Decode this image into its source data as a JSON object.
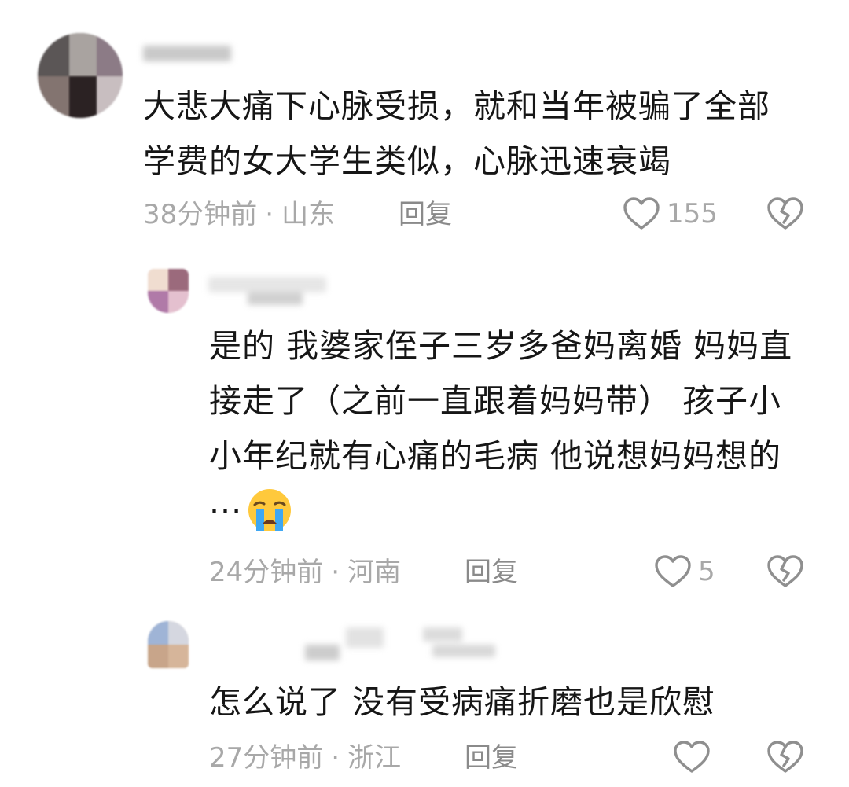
{
  "comments": [
    {
      "text": "大悲大痛下心脉受损，就和当年被骗了全部学费的女大学生类似，心脉迅速衰竭",
      "time": "38分钟前",
      "location": "山东",
      "reply_label": "回复",
      "likes": "155"
    },
    {
      "text": "是的 我婆家侄子三岁多爸妈离婚 妈妈直接走了（之前一直跟着妈妈带） 孩子小小年纪就有心痛的毛病 他说想妈妈想的···",
      "emoji": "crying-face",
      "time": "24分钟前",
      "location": "河南",
      "reply_label": "回复",
      "likes": "5"
    },
    {
      "text": "怎么说了 没有受病痛折磨也是欣慰",
      "time": "27分钟前",
      "location": "浙江",
      "reply_label": "回复",
      "likes": ""
    }
  ],
  "separator": "·",
  "icons": {
    "like": "heart-outline-icon",
    "dislike": "broken-heart-icon"
  },
  "colors": {
    "text": "#161616",
    "meta": "#a8a8a8",
    "icon": "#8f8f8f"
  }
}
